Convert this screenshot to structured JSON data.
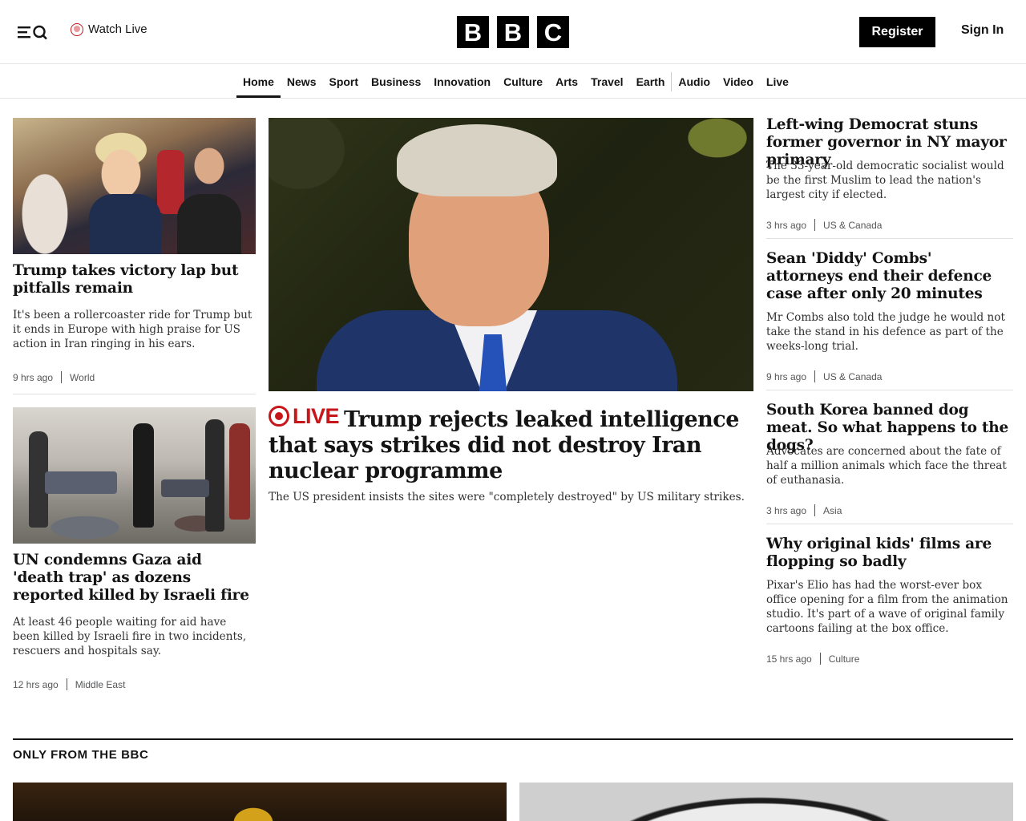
{
  "header": {
    "watch_live": "Watch Live",
    "logo_letters": [
      "B",
      "B",
      "C"
    ],
    "register": "Register",
    "sign_in": "Sign In"
  },
  "nav": {
    "items": [
      "Home",
      "News",
      "Sport",
      "Business",
      "Innovation",
      "Culture",
      "Arts",
      "Travel",
      "Earth",
      "Audio",
      "Video",
      "Live"
    ],
    "active": "Home"
  },
  "left_stories": [
    {
      "headline": "Trump takes victory lap but pitfalls remain",
      "summary": "It's been a rollercoaster ride for Trump but it ends in Europe with high praise for US action in Iran ringing in his ears.",
      "time": "9 hrs ago",
      "category": "World"
    },
    {
      "headline": "UN condemns Gaza aid 'death trap' as dozens reported killed by Israeli fire",
      "summary": "At least 46 people waiting for aid have been killed by Israeli fire in two incidents, rescuers and hospitals say.",
      "time": "12 hrs ago",
      "category": "Middle East"
    }
  ],
  "main_story": {
    "live_label": "LIVE",
    "headline": "Trump rejects leaked intelligence that says strikes did not destroy Iran nuclear programme",
    "summary": "The US president insists the sites were \"completely destroyed\" by US military strikes."
  },
  "right_stories": [
    {
      "headline": "Left-wing Democrat stuns former governor in NY mayor primary",
      "summary": "The 33-year-old democratic socialist would be the first Muslim to lead the nation's largest city if elected.",
      "time": "3 hrs ago",
      "category": "US & Canada"
    },
    {
      "headline": "Sean 'Diddy' Combs' attorneys end their defence case after only 20 minutes",
      "summary": "Mr Combs also told the judge he would not take the stand in his defence as part of the weeks-long trial.",
      "time": "9 hrs ago",
      "category": "US & Canada"
    },
    {
      "headline": "South Korea banned dog meat. So what happens to the dogs?",
      "summary": "Advocates are concerned about the fate of half a million animals which face the threat of euthanasia.",
      "time": "3 hrs ago",
      "category": "Asia"
    },
    {
      "headline": "Why original kids' films are flopping so badly",
      "summary": "Pixar's Elio has had the worst-ever box office opening for a film from the animation studio. It's part of a wave of original family cartoons failing at the box office.",
      "time": "15 hrs ago",
      "category": "Culture"
    }
  ],
  "section": {
    "title": "ONLY FROM THE BBC"
  },
  "colors": {
    "live_red": "#c6161a",
    "text": "#141414",
    "meta": "#545658",
    "button_bg": "#000000"
  },
  "icons": {
    "menu": "menu-search-icon",
    "watch_live": "live-dot-icon",
    "live_tag": "live-ring-icon"
  }
}
